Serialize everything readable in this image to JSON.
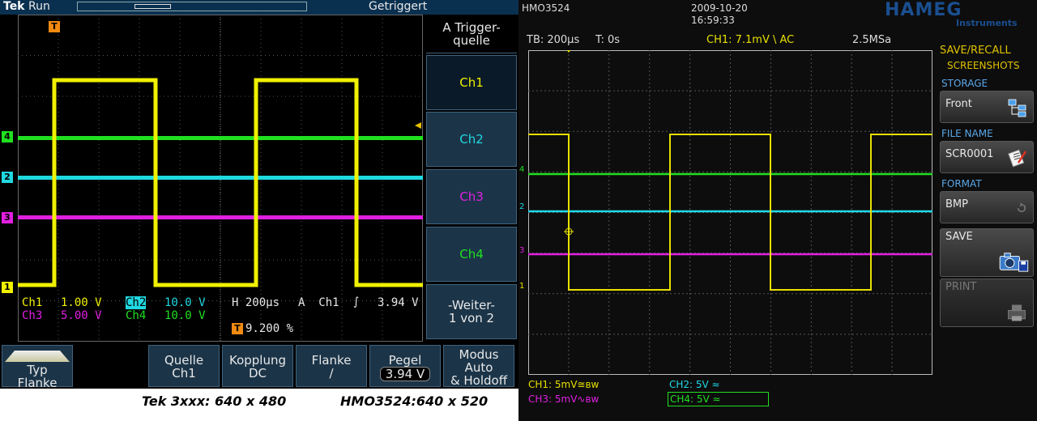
{
  "tek": {
    "brand": "Tek",
    "run": "Run",
    "trigger_status": "Getriggert",
    "side_header": "A Trigger-\nquelle",
    "side_buttons": [
      "Ch1",
      "Ch2",
      "Ch3",
      "Ch4"
    ],
    "side_more": "-Weiter-\n1 von 2",
    "bottom_buttons": [
      {
        "label": "Typ",
        "value": "Flanke"
      },
      {
        "label": "Quelle",
        "value": "Ch1"
      },
      {
        "label": "Kopplung",
        "value": "DC"
      },
      {
        "label": "Flanke",
        "value": "∕"
      },
      {
        "label": "Pegel",
        "value": "3.94 V"
      },
      {
        "label": "Modus",
        "value": "Auto\n& Holdoff"
      }
    ],
    "readout": {
      "ch1_name": "Ch1",
      "ch1_scale": "1.00 V",
      "ch2_name": "Ch2",
      "ch2_scale": "10.0 V",
      "ch3_name": "Ch3",
      "ch3_scale": "5.00 V",
      "ch4_name": "Ch4",
      "ch4_scale": "10.0 V",
      "horizontal": "H 200µs",
      "trigger_src": "A  Ch1",
      "trigger_level": "3.94 V",
      "trigger_pos": "9.200 %"
    },
    "markers": [
      "1",
      "2",
      "3",
      "4"
    ],
    "trigger_marker": "T",
    "colors": {
      "ch1": "#f0f000",
      "ch2": "#20d8e0",
      "ch3": "#e020e0",
      "ch4": "#20e020"
    }
  },
  "captions": {
    "tek": "Tek 3xxx: 640 x 480",
    "hmo": "HMO3524:640 x 520"
  },
  "hmo": {
    "model": "HMO3524",
    "date": "2009-10-20",
    "time": "16:59:33",
    "logo": "HAMEG",
    "logo_sub": "Instruments",
    "timebase": "TB: 200µs",
    "trig_time": "T: 0s",
    "ch1_info": "CH1: 7.1mV \\ AC",
    "sample_rate": "2.5MSa",
    "menu_title": "SAVE/RECALL",
    "menu_subtitle": "SCREENSHOTS",
    "storage_label": "STORAGE",
    "storage_value": "Front",
    "filename_label": "FILE NAME",
    "filename_value": "SCR0001",
    "format_label": "FORMAT",
    "format_value": "BMP",
    "save_label": "SAVE",
    "print_label": "PRINT",
    "bottom": {
      "ch1": "CH1: 5mV≅ʙᴡ",
      "ch2": "CH2: 5V ≈",
      "ch3": "CH3: 5mV∿ʙᴡ",
      "ch4": "CH4: 5V ≈"
    },
    "markers": [
      "1",
      "2",
      "3",
      "4"
    ],
    "colors": {
      "ch1": "#e8e000",
      "ch2": "#20d8e8",
      "ch3": "#e020e0",
      "ch4": "#20e020",
      "accent": "#e0c200",
      "label": "#5aa8e8"
    }
  }
}
